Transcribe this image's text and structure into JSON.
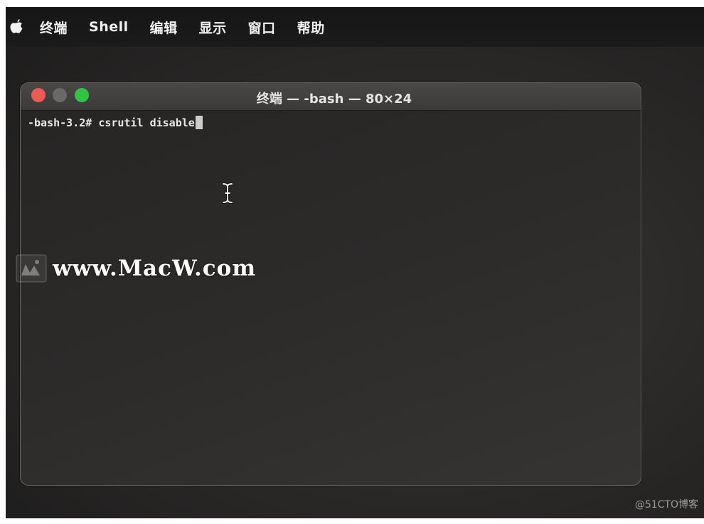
{
  "menubar": {
    "apple_icon": "apple-logo-icon",
    "items": [
      {
        "label": "终端"
      },
      {
        "label": "Shell"
      },
      {
        "label": "编辑"
      },
      {
        "label": "显示"
      },
      {
        "label": "窗口"
      },
      {
        "label": "帮助"
      }
    ]
  },
  "window": {
    "title": "终端 — -bash — 80×24",
    "traffic_colors": {
      "close": "#ee5a52",
      "minimize": "#6b6967",
      "maximize": "#2fc443"
    }
  },
  "terminal": {
    "prompt": "-bash-3.2#",
    "command": "csrutil disable"
  },
  "watermark": {
    "text": "www.MacW.com"
  },
  "credit": {
    "text": "@51CTO博客"
  }
}
